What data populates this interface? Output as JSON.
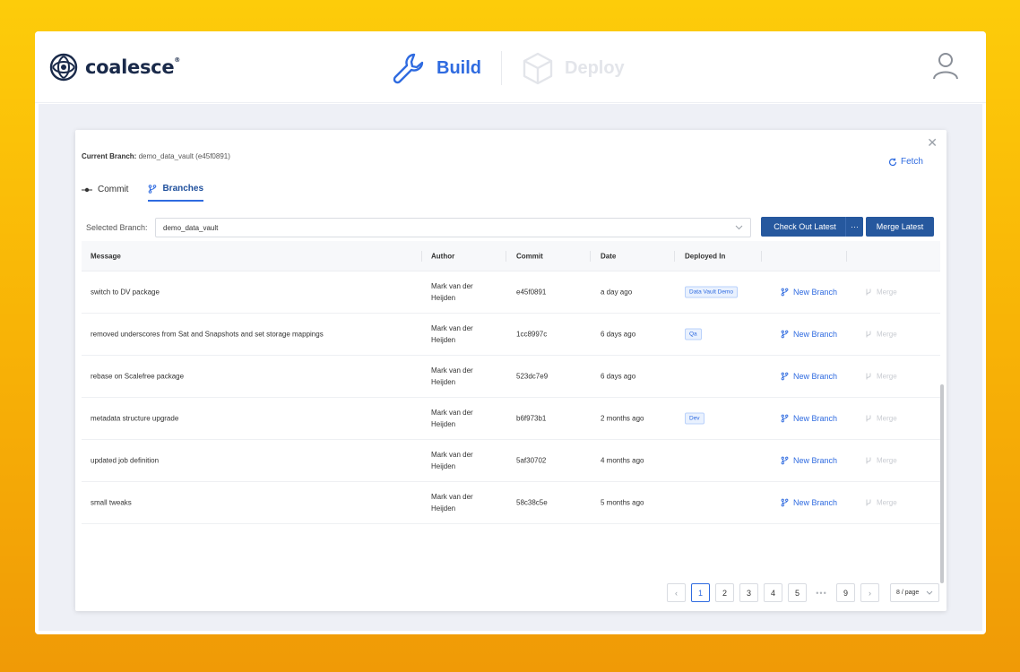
{
  "brand": {
    "name": "coalesce",
    "mark": "®"
  },
  "modes": {
    "build": "Build",
    "deploy": "Deploy"
  },
  "dialog": {
    "current_branch_label": "Current Branch:",
    "current_branch_value": "demo_data_vault (e45f0891)",
    "fetch_label": "Fetch",
    "tabs": [
      {
        "label": "Commit"
      },
      {
        "label": "Branches"
      }
    ],
    "selected_branch_label": "Selected Branch:",
    "selected_branch_value": "demo_data_vault",
    "checkout_label": "Check Out Latest",
    "checkout_more": "···",
    "merge_latest_label": "Merge Latest"
  },
  "table": {
    "headers": {
      "message": "Message",
      "author": "Author",
      "commit": "Commit",
      "date": "Date",
      "deployed": "Deployed In"
    },
    "action_new_branch": "New Branch",
    "action_merge": "Merge",
    "rows": [
      {
        "message": "switch to DV package",
        "author_1": "Mark van der",
        "author_2": "Heijden",
        "commit": "e45f0891",
        "date": "a day ago",
        "deployed": "Data Vault Demo"
      },
      {
        "message": "removed underscores from Sat and Snapshots and set storage mappings",
        "author_1": "Mark van der",
        "author_2": "Heijden",
        "commit": "1cc8997c",
        "date": "6 days ago",
        "deployed": "Qa"
      },
      {
        "message": "rebase on Scalefree package",
        "author_1": "Mark van der",
        "author_2": "Heijden",
        "commit": "523dc7e9",
        "date": "6 days ago",
        "deployed": ""
      },
      {
        "message": "metadata structure upgrade",
        "author_1": "Mark van der",
        "author_2": "Heijden",
        "commit": "b6f973b1",
        "date": "2 months ago",
        "deployed": "Dev"
      },
      {
        "message": "updated job definition",
        "author_1": "Mark van der",
        "author_2": "Heijden",
        "commit": "5af30702",
        "date": "4 months ago",
        "deployed": ""
      },
      {
        "message": "small tweaks",
        "author_1": "Mark van der",
        "author_2": "Heijden",
        "commit": "58c38c5e",
        "date": "5 months ago",
        "deployed": ""
      }
    ]
  },
  "pagination": {
    "pages": [
      "1",
      "2",
      "3",
      "4",
      "5"
    ],
    "ellipsis": "•••",
    "last": "9",
    "prev": "‹",
    "next": "›",
    "page_size": "8 / page",
    "current": 1
  },
  "colors": {
    "accent": "#2f6be0",
    "primary_button": "#26589e",
    "background_gradient_top": "#fdcc0a",
    "background_gradient_bottom": "#f09a06"
  }
}
